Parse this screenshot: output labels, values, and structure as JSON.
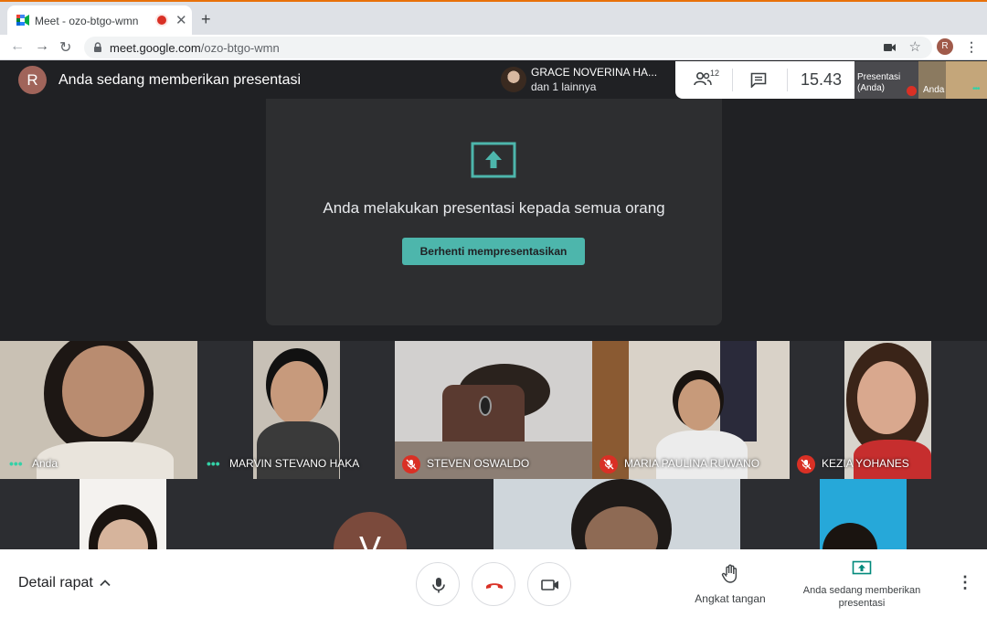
{
  "browser": {
    "tab_title": "Meet - ozo-btgo-wmn",
    "close_glyph": "✕",
    "new_tab_glyph": "+",
    "url_host": "meet.google.com",
    "url_path": "/ozo-btgo-wmn",
    "profile_initial": "R",
    "nav_back": "←",
    "nav_forward": "→",
    "nav_reload": "↻",
    "star_glyph": "☆",
    "menu_glyph": "⋮"
  },
  "meet_top": {
    "user_initial": "R",
    "presenting_banner": "Anda sedang memberikan presentasi",
    "speaker_name": "GRACE NOVERINA HA...",
    "speaker_more": "dan 1 lainnya",
    "people_count": "12",
    "clock": "15.43",
    "self_preview_label": "Presentasi (Anda)",
    "self_preview_name": "Anda",
    "dots": "•••"
  },
  "stage": {
    "message": "Anda melakukan presentasi kepada semua orang",
    "stop_button": "Berhenti mempresentasikan"
  },
  "tiles": [
    {
      "name": "Anda",
      "state": "speaking"
    },
    {
      "name": "MARVIN STEVANO HAKA",
      "state": "speaking"
    },
    {
      "name": "STEVEN OSWALDO",
      "state": "muted"
    },
    {
      "name": "MARIA PAULINA RUWANO",
      "state": "muted"
    },
    {
      "name": "KEZIA YOHANES",
      "state": "muted"
    }
  ],
  "second_row": {
    "avatar_initial": "V"
  },
  "bottom_bar": {
    "details": "Detail rapat",
    "raise_hand": "Angkat tangan",
    "presenting": "Anda sedang memberikan presentasi",
    "more_glyph": "⋮"
  },
  "colors": {
    "accent": "#4db6ac",
    "muted_red": "#d93025",
    "speaking_green": "#34d1a7",
    "background": "#202124"
  }
}
